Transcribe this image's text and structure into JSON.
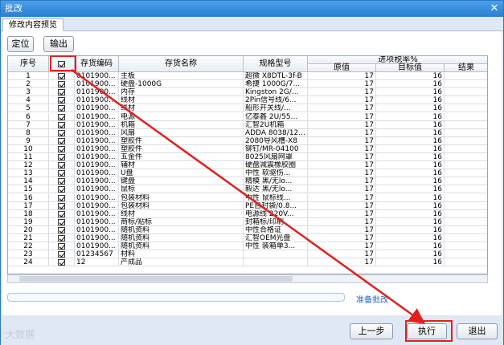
{
  "window": {
    "title": "批改",
    "close_glyph": "✕"
  },
  "tab": {
    "label": "修改内容预览"
  },
  "toolbar": {
    "locate_label": "定位",
    "export_label": "输出"
  },
  "grid": {
    "headers": {
      "seq": "序号",
      "code": "存货编码",
      "name": "存货名称",
      "spec": "规格型号",
      "tax_group": "进项税率%",
      "original": "原值",
      "target": "目标值",
      "result": "结果"
    },
    "rows": [
      {
        "seq": "1",
        "code": "0101900...",
        "name": "主板",
        "spec": "超微 X8DTL-3f-B",
        "original": "17",
        "target": "16"
      },
      {
        "seq": "2",
        "code": "0101900...",
        "name": "硬盘-1000G",
        "spec": "希捷 1000G/7...",
        "original": "17",
        "target": "16"
      },
      {
        "seq": "3",
        "code": "0101900...",
        "name": "内存",
        "spec": "Kingston 2G/...",
        "original": "17",
        "target": "16"
      },
      {
        "seq": "4",
        "code": "0101900...",
        "name": "线材",
        "spec": "2Pin信号线/6...",
        "original": "17",
        "target": "16"
      },
      {
        "seq": "5",
        "code": "0101900...",
        "name": "线材",
        "spec": "船形开关线/...",
        "original": "17",
        "target": "16"
      },
      {
        "seq": "6",
        "code": "0101900...",
        "name": "电源",
        "spec": "亿泰鑫 2U/55...",
        "original": "17",
        "target": "16"
      },
      {
        "seq": "7",
        "code": "0101900...",
        "name": "机箱",
        "spec": "汇智2U机箱",
        "original": "17",
        "target": "16"
      },
      {
        "seq": "8",
        "code": "0101900...",
        "name": "风扇",
        "spec": "ADDA 8038/12...",
        "original": "17",
        "target": "16"
      },
      {
        "seq": "9",
        "code": "0101900...",
        "name": "塑胶件",
        "spec": "2080导风槽-X8",
        "original": "17",
        "target": "16"
      },
      {
        "seq": "10",
        "code": "0101900...",
        "name": "塑胶件",
        "spec": "铆钉/MR-04100",
        "original": "17",
        "target": "16"
      },
      {
        "seq": "11",
        "code": "0101900...",
        "name": "五金件",
        "spec": "8025风扇网罩",
        "original": "17",
        "target": "16"
      },
      {
        "seq": "12",
        "code": "0101900...",
        "name": "辅材",
        "spec": "硬盘减震橡胶圈",
        "original": "17",
        "target": "16"
      },
      {
        "seq": "13",
        "code": "0101900...",
        "name": "U盘",
        "spec": "中性 软驱伤...",
        "original": "17",
        "target": "16"
      },
      {
        "seq": "14",
        "code": "0101900...",
        "name": "键盘",
        "spec": "精模 黑/无lo...",
        "original": "17",
        "target": "16"
      },
      {
        "seq": "15",
        "code": "0101900...",
        "name": "鼠标",
        "spec": "毅达 黑/无lo...",
        "original": "17",
        "target": "16"
      },
      {
        "seq": "16",
        "code": "0101900...",
        "name": "包装材料",
        "spec": "中性 鼠标线...",
        "original": "17",
        "target": "16"
      },
      {
        "seq": "17",
        "code": "0101900...",
        "name": "包装材料",
        "spec": "PE自封袋/0.8...",
        "original": "17",
        "target": "16"
      },
      {
        "seq": "18",
        "code": "0101900...",
        "name": "线材",
        "spec": "电源线 220V...",
        "original": "17",
        "target": "16"
      },
      {
        "seq": "19",
        "code": "0101900...",
        "name": "商标/贴标",
        "spec": "封箱标/印刷",
        "original": "17",
        "target": "16"
      },
      {
        "seq": "20",
        "code": "0101900...",
        "name": "随机资料",
        "spec": "中性合格证",
        "original": "17",
        "target": "16"
      },
      {
        "seq": "21",
        "code": "0101900...",
        "name": "随机资料",
        "spec": "汇智OEM光盘",
        "original": "17",
        "target": "16"
      },
      {
        "seq": "22",
        "code": "0101900...",
        "name": "随机资料",
        "spec": "中性 装箱单3...",
        "original": "17",
        "target": "16"
      },
      {
        "seq": "23",
        "code": "01234567",
        "name": "材料",
        "spec": "",
        "original": "17",
        "target": "16"
      },
      {
        "seq": "24",
        "code": "12",
        "name": "产成品",
        "spec": "",
        "original": "17",
        "target": "16"
      }
    ]
  },
  "status": {
    "text": "准备批改"
  },
  "footer": {
    "prev_label": "上一步",
    "execute_label": "执行",
    "exit_label": "退出",
    "brand": "大数据"
  },
  "colors": {
    "accent": "#2b7fd1",
    "highlight": "#e02020"
  }
}
